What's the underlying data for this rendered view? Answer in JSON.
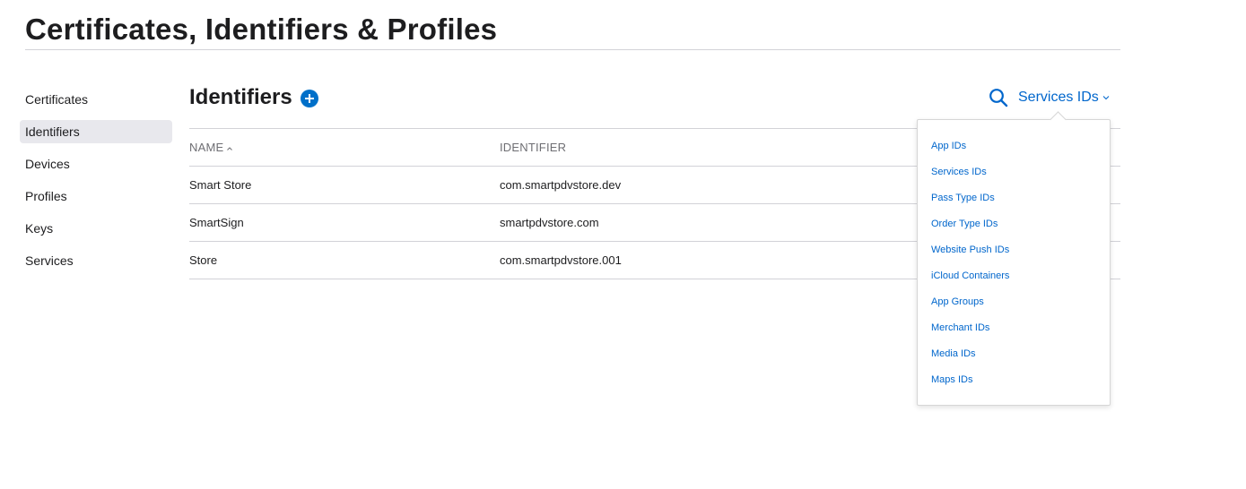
{
  "page": {
    "title": "Certificates, Identifiers & Profiles"
  },
  "sidebar": {
    "items": [
      {
        "label": "Certificates",
        "active": false
      },
      {
        "label": "Identifiers",
        "active": true
      },
      {
        "label": "Devices",
        "active": false
      },
      {
        "label": "Profiles",
        "active": false
      },
      {
        "label": "Keys",
        "active": false
      },
      {
        "label": "Services",
        "active": false
      }
    ]
  },
  "main": {
    "title": "Identifiers",
    "add_icon": "plus-circle-icon",
    "search_icon": "search-icon",
    "filter": {
      "selected": "Services IDs",
      "icon": "chevron-down-icon"
    }
  },
  "table": {
    "columns": [
      {
        "label": "NAME",
        "sort": "ascending"
      },
      {
        "label": "IDENTIFIER"
      }
    ],
    "rows": [
      {
        "name": "Smart Store",
        "identifier": "com.smartpdvstore.dev"
      },
      {
        "name": "SmartSign",
        "identifier": "smartpdvstore.com"
      },
      {
        "name": "Store",
        "identifier": "com.smartpdvstore.001"
      }
    ]
  },
  "dropdown": {
    "options": [
      "App IDs",
      "Services IDs",
      "Pass Type IDs",
      "Order Type IDs",
      "Website Push IDs",
      "iCloud Containers",
      "App Groups",
      "Merchant IDs",
      "Media IDs",
      "Maps IDs"
    ]
  },
  "colors": {
    "accent": "#0070c9",
    "link": "#0066cc",
    "text": "#1d1d1f",
    "muted": "#6e6e73",
    "divider": "#d2d2d7",
    "active_bg": "#e8e8ed"
  }
}
